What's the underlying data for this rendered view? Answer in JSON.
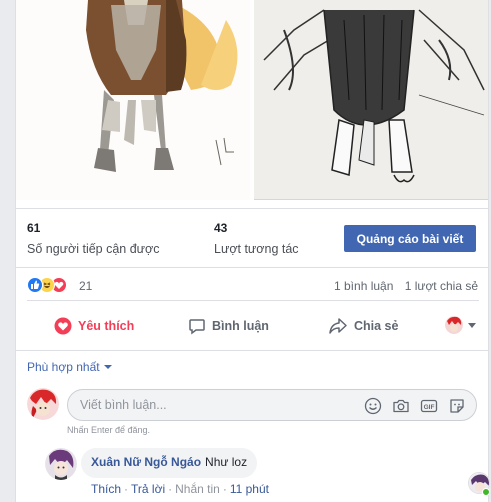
{
  "insights": {
    "reach_count": "61",
    "reach_label": "Số người tiếp cận được",
    "engagement_count": "43",
    "engagement_label": "Lượt tương tác",
    "boost_label": "Quảng cáo bài viết"
  },
  "reactions": {
    "count": "21",
    "types": [
      "like",
      "haha",
      "love"
    ],
    "comments": "1 bình luận",
    "shares": "1 lượt chia sẻ"
  },
  "actions": {
    "like": "Yêu thích",
    "comment": "Bình luận",
    "share": "Chia sẻ"
  },
  "comments": {
    "sort": "Phù hợp nhất",
    "placeholder": "Viết bình luận...",
    "hint": "Nhấn Enter để đăng.",
    "items": [
      {
        "author": "Xuân Nữ Ngỗ Ngáo",
        "text": "Như loz",
        "like": "Thích",
        "reply": "Trả lời",
        "message": "Nhắn tin",
        "time": "11 phút"
      }
    ]
  },
  "colors": {
    "accent": "#4267b2",
    "love": "#f33e58",
    "link": "#385898"
  }
}
